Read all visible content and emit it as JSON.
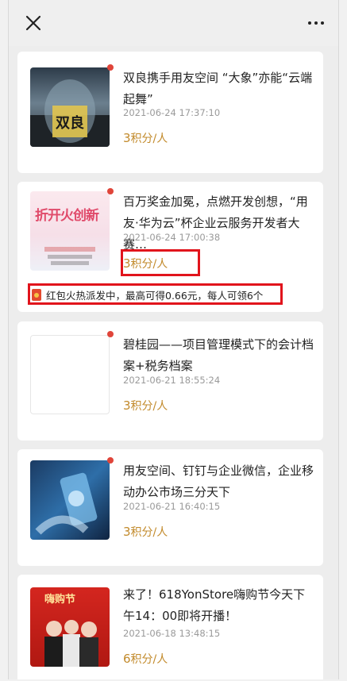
{
  "header": {
    "close_icon": "close-icon",
    "more_icon": "more-icon"
  },
  "articles": [
    {
      "title": "双良携手用友空间 “大象”亦能“云端起舞”",
      "date": "2021-06-24 17:37:10",
      "points_num": "3",
      "points_unit": "积分/人",
      "thumb_text": "双良"
    },
    {
      "title": "百万奖金加冕，点燃开发创想，“用友·华为云”杯企业云服务开发者大赛…",
      "date": "2021-06-24 17:00:38",
      "points_num": "3",
      "points_unit": "积分/人",
      "red_packet": "红包火热派发中，最高可得0.66元，每人可领6个",
      "thumb_text": "折开火创新"
    },
    {
      "title": "碧桂园——项目管理模式下的会计档案+税务档案",
      "date": "2021-06-21 18:55:24",
      "points_num": "3",
      "points_unit": "积分/人"
    },
    {
      "title": "用友空间、钉钉与企业微信，企业移动办公市场三分天下",
      "date": "2021-06-21 16:40:15",
      "points_num": "3",
      "points_unit": "积分/人"
    },
    {
      "title": "来了！618YonStore嗨购节今天下午14：00即将开播！",
      "date": "2021-06-18 13:48:15",
      "points_num": "6",
      "points_unit": "积分/人",
      "thumb_text": "嗨购节"
    }
  ],
  "colors": {
    "accent_gold": "#c28a2b",
    "unread_dot": "#e0453a",
    "highlight_red": "#e1141c"
  }
}
